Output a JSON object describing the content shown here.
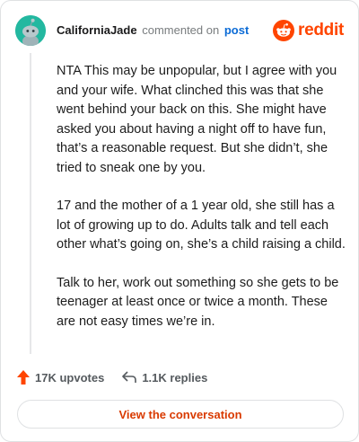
{
  "header": {
    "author": "CaliforniaJade",
    "action_text": "commented on",
    "post_link": "post",
    "logo_text": "reddit"
  },
  "comment": {
    "paragraphs": [
      "NTA This may be unpopular, but I agree with you and your wife. What clinched this was that she went behind your back on this. She might have asked you about having a night off to have fun, that’s a reasonable request. But she didn’t, she tried to sneak one by you.",
      "17 and the mother of a 1 year old, she still has a lot of growing up to do. Adults talk and tell each other what’s going on, she’s a child raising a child.",
      "Talk to her, work out something so she gets to be teenager at least once or twice a month. These are not easy times we’re in."
    ]
  },
  "actions": {
    "upvotes": "17K upvotes",
    "replies": "1.1K replies"
  },
  "cta": {
    "label": "View the conversation"
  },
  "icons": {
    "avatar": "snoo-avatar-icon",
    "logo": "reddit-snoo-icon",
    "upvote": "upvote-arrow-icon",
    "reply": "reply-arrow-icon"
  },
  "colors": {
    "brand": "#ff4500",
    "link": "#0b6bd6",
    "avatar_bg": "#23b8a0",
    "cta_text": "#d93a00"
  }
}
